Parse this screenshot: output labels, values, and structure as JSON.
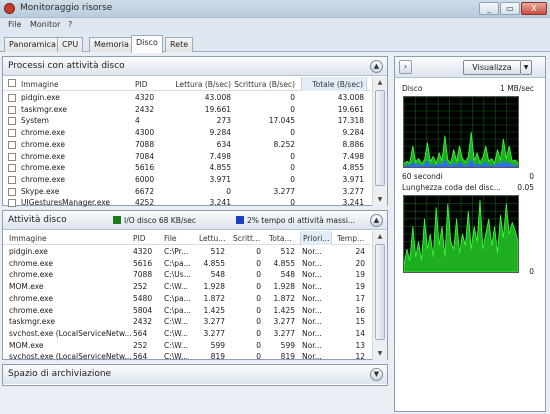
{
  "window": {
    "title": "Monitoraggio risorse",
    "buttons": [
      "_",
      "▭",
      "X"
    ]
  },
  "menu": [
    "File",
    "Monitor",
    "?"
  ],
  "tabs": [
    {
      "label": "Panoramica",
      "active": false
    },
    {
      "label": "CPU",
      "active": false
    },
    {
      "label": "Memoria",
      "active": false
    },
    {
      "label": "Disco",
      "active": true
    },
    {
      "label": "Rete",
      "active": false
    }
  ],
  "processes": {
    "title": "Processi con attività disco",
    "columns": [
      "Immagine",
      "PID",
      "Lettura (B/sec)",
      "Scrittura (B/sec)",
      "Totale (B/sec)"
    ],
    "rows": [
      [
        "pidgin.exe",
        "4320",
        "43.008",
        "0",
        "43.008"
      ],
      [
        "taskmgr.exe",
        "2432",
        "19.661",
        "0",
        "19.661"
      ],
      [
        "System",
        "4",
        "273",
        "17.045",
        "17.318"
      ],
      [
        "chrome.exe",
        "4300",
        "9.284",
        "0",
        "9.284"
      ],
      [
        "chrome.exe",
        "7088",
        "634",
        "8.252",
        "8.886"
      ],
      [
        "chrome.exe",
        "7084",
        "7.498",
        "0",
        "7.498"
      ],
      [
        "chrome.exe",
        "5616",
        "4.855",
        "0",
        "4.855"
      ],
      [
        "chrome.exe",
        "6000",
        "3.971",
        "0",
        "3.971"
      ],
      [
        "Skype.exe",
        "6672",
        "0",
        "3.277",
        "3.277"
      ],
      [
        "UIGesturesManager.exe",
        "4252",
        "3.241",
        "0",
        "3.241"
      ]
    ]
  },
  "disk_activity": {
    "title": "Attività disco",
    "legend1": "I/O disco 68 KB/sec",
    "legend2": "2% tempo di attività massi...",
    "legend1_color": "#1a7d1a",
    "legend2_color": "#1f3fbf",
    "columns": [
      "Immagine",
      "PID",
      "File",
      "Lettu...",
      "Scritt...",
      "Tota...",
      "Priori...",
      "Temp..."
    ],
    "rows": [
      [
        "pidgin.exe",
        "4320",
        "C:\\Pr...",
        "512",
        "0",
        "512",
        "Nor...",
        "24"
      ],
      [
        "chrome.exe",
        "5616",
        "C:\\pa...",
        "4.855",
        "0",
        "4.855",
        "Nor...",
        "20"
      ],
      [
        "chrome.exe",
        "7088",
        "C:\\Us...",
        "548",
        "0",
        "548",
        "Nor...",
        "19"
      ],
      [
        "MOM.exe",
        "252",
        "C:\\W...",
        "1.928",
        "0",
        "1.928",
        "Nor...",
        "19"
      ],
      [
        "chrome.exe",
        "5480",
        "C:\\pa...",
        "1.872",
        "0",
        "1.872",
        "Nor...",
        "17"
      ],
      [
        "chrome.exe",
        "5804",
        "C:\\pa...",
        "1.425",
        "0",
        "1.425",
        "Nor...",
        "16"
      ],
      [
        "taskmgr.exe",
        "2432",
        "C:\\W...",
        "3.277",
        "0",
        "3.277",
        "Nor...",
        "15"
      ],
      [
        "svchost.exe (LocalServiceNetw...",
        "564",
        "C:\\W...",
        "3.277",
        "0",
        "3.277",
        "Nor...",
        "14"
      ],
      [
        "MOM.exe",
        "252",
        "C:\\W...",
        "599",
        "0",
        "599",
        "Nor...",
        "13"
      ],
      [
        "svchost.exe (LocalServiceNetw...",
        "564",
        "C:\\W...",
        "819",
        "0",
        "819",
        "Nor...",
        "12"
      ]
    ]
  },
  "storage": {
    "title": "Spazio di archiviazione"
  },
  "right_panel": {
    "nav_symbol": "›",
    "view_button": "Visualizza",
    "graph1": {
      "title": "Disco",
      "max": "1 MB/sec",
      "time": "60 secondi",
      "min": "0"
    },
    "graph2": {
      "title": "Lunghezza coda del disc...",
      "max": "0.05",
      "min": "0"
    },
    "graph_colors": {
      "grid": "#0b5d12",
      "line": "#3cff3c",
      "fill": "#1fae1f",
      "blue": "#2f6bff"
    }
  }
}
